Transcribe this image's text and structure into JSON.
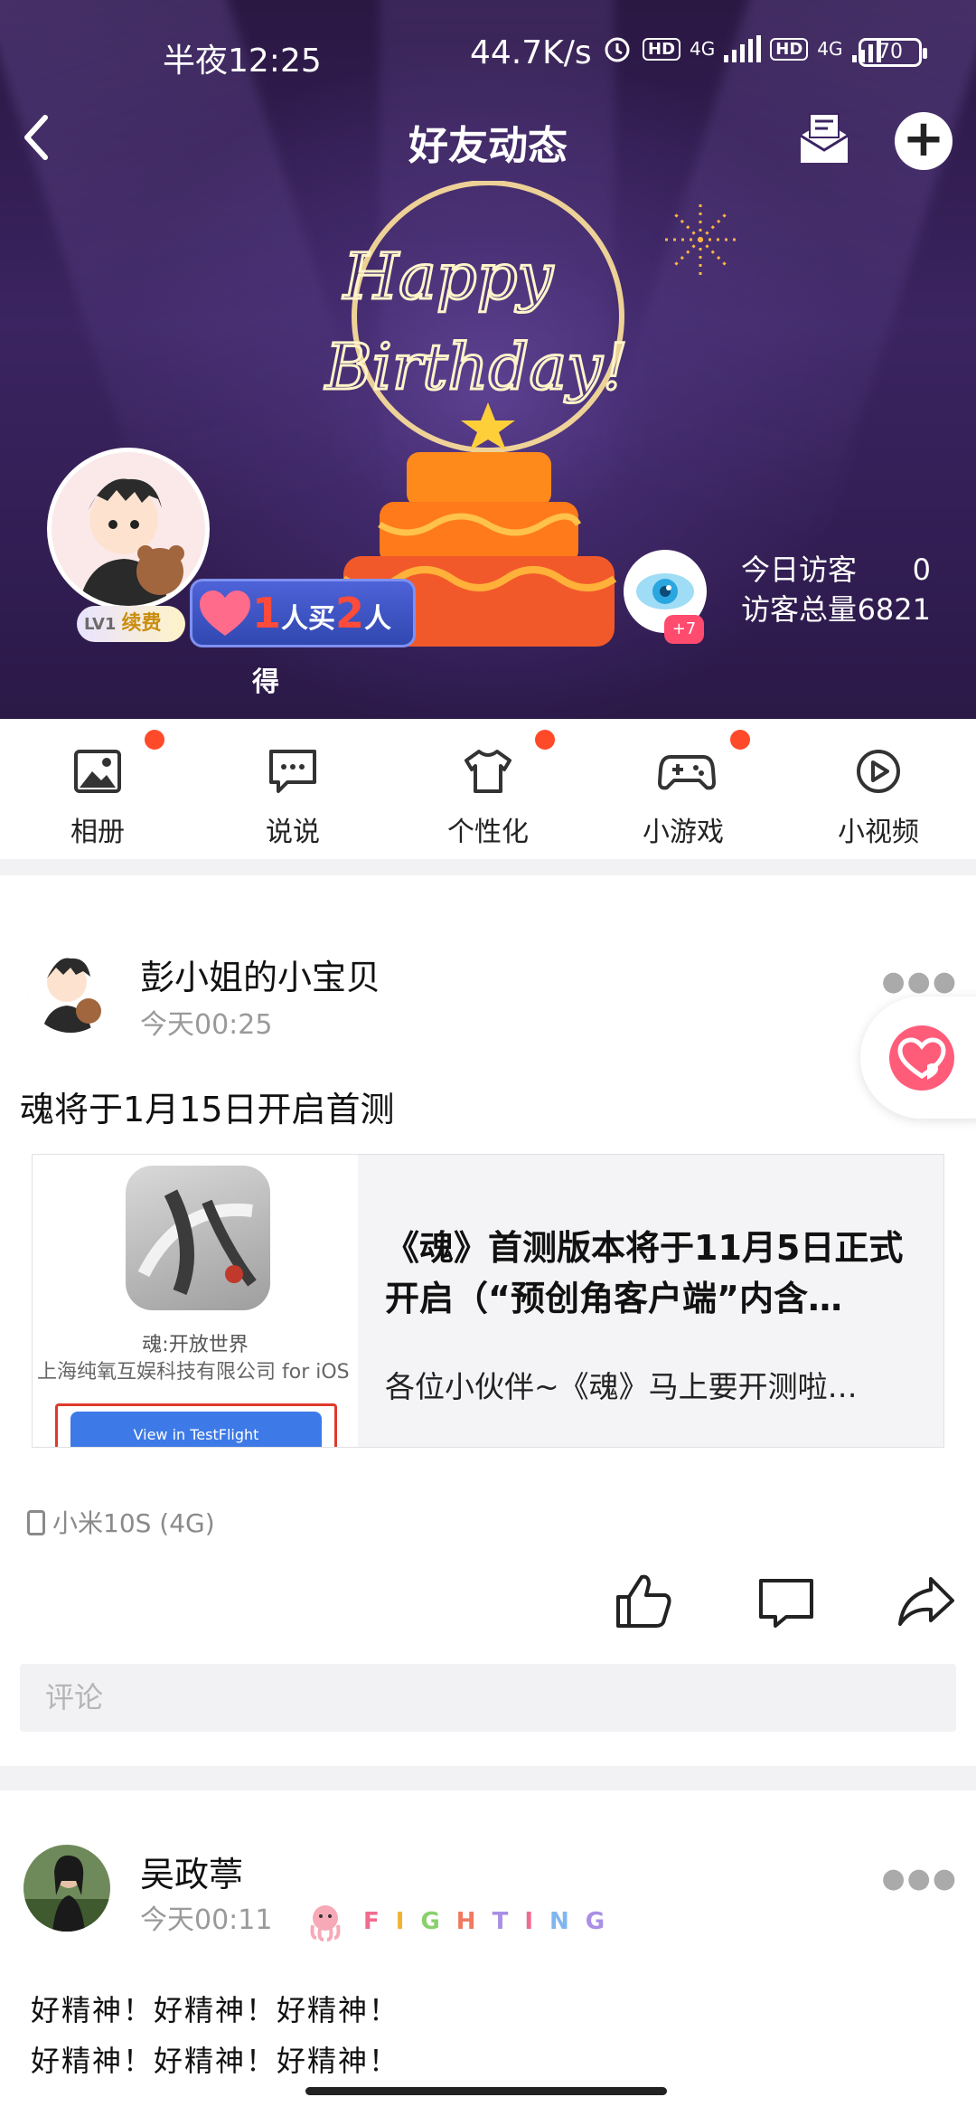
{
  "status_bar": {
    "time": "半夜12:25",
    "net_speed": "44.7K/s",
    "net_type": "4G",
    "hd": "HD",
    "battery": "70"
  },
  "nav": {
    "title": "好友动态"
  },
  "header": {
    "promo": {
      "num1": "1",
      "text1": "人买",
      "num2": "2",
      "text2": "人得"
    },
    "level": {
      "lv": "LV1",
      "renew": "续费"
    },
    "visitor_badge": "+7",
    "today_visitors_label": "今日访客",
    "today_visitors": "0",
    "total_visitors_label": "访客总量",
    "total_visitors": "6821"
  },
  "toolbar": {
    "items": [
      {
        "label": "相册"
      },
      {
        "label": "说说"
      },
      {
        "label": "个性化"
      },
      {
        "label": "小游戏"
      },
      {
        "label": "小视频"
      }
    ]
  },
  "post1": {
    "author": "彭小姐的小宝贝",
    "time": "今天00:25",
    "text": "魂将于1月15日开启首测",
    "share": {
      "app_name": "魂:开放世界",
      "app_company": "上海纯氧互娱科技有限公司 for iOS",
      "app_button": "View in TestFlight",
      "title": "《魂》首测版本将于11月5日正式开启（“预创角客户端”内含…",
      "desc": "各位小伙伴~《魂》马上要开测啦…"
    },
    "device": "小米10S (4G)",
    "comment_placeholder": "评论"
  },
  "post2": {
    "author": "吴政葶",
    "time": "今天00:11",
    "sticker_letters": [
      "F",
      "I",
      "G",
      "H",
      "T",
      "I",
      "N",
      "G"
    ],
    "line1": "好精神！好精神！好精神！",
    "line2": "好精神！好精神！好精神！"
  },
  "colors": {
    "red_dot": "#ff4a2a",
    "header_bg": "#3b2461",
    "like_pink": "#ff5c7a"
  }
}
